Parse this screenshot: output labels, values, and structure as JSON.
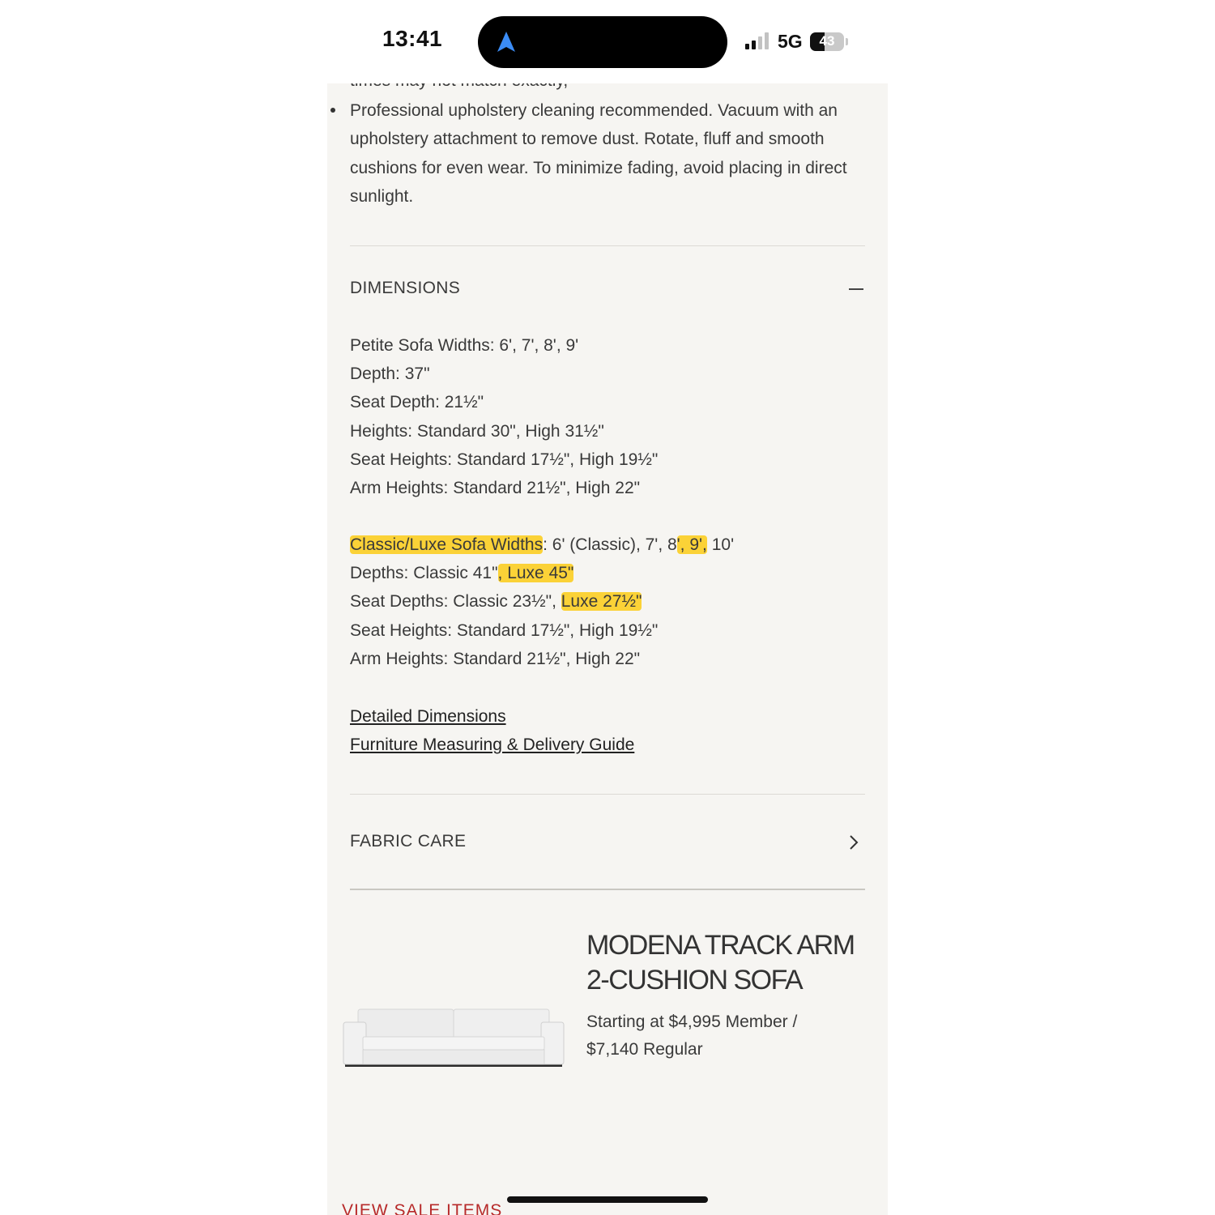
{
  "status_bar": {
    "time": "13:41",
    "network": "5G",
    "battery_percent": "43",
    "battery_level": 0.43
  },
  "care": {
    "clipped_line": "times may not match exactly,",
    "bullet_text": "Professional upholstery cleaning recommended. Vacuum with an upholstery attachment to remove dust. Rotate, fluff and smooth cushions for even wear. To minimize fading, avoid placing in direct sunlight."
  },
  "dimensions": {
    "title": "DIMENSIONS",
    "petite": [
      "Petite Sofa Widths: 6', 7', 8', 9'",
      "Depth: 37\"",
      "Seat Depth: 21½\"",
      "Heights: Standard 30\", High 31½\"",
      "Seat Heights: Standard 17½\", High 19½\"",
      "Arm Heights: Standard 21½\", High 22\""
    ],
    "classic": {
      "widths_label": "Classic/Luxe Sofa Widths",
      "widths_value_a": ": 6' (Classic), 7', 8",
      "widths_value_hl": "', 9',",
      "widths_value_b": " 10'",
      "depths_a": "Depths: Classic 41\"",
      "depths_hl": ", Luxe 45\"",
      "seat_depths_a": "Seat Depths: Classic 23½\", ",
      "seat_depths_hl": "Luxe 27½\"",
      "seat_heights": "Seat Heights: Standard 17½\", High 19½\"",
      "arm_heights": "Arm Heights: Standard 21½\", High 22\""
    },
    "links": [
      "Detailed Dimensions",
      "Furniture Measuring & Delivery Guide"
    ]
  },
  "fabric_care": {
    "title": "FABRIC CARE"
  },
  "product": {
    "name": "MODENA TRACK ARM 2-CUSHION SOFA",
    "price": "Starting at $4,995 Member / $7,140 Regular"
  },
  "footer": {
    "sale_link": "VIEW SALE ITEMS"
  },
  "colors": {
    "highlight": "#fbd237",
    "sale_red": "#b72a2a",
    "background": "#f6f5f2"
  },
  "icons": [
    "location-arrow-icon",
    "signal-bars-icon",
    "battery-icon",
    "minus-icon",
    "chevron-right-icon"
  ]
}
